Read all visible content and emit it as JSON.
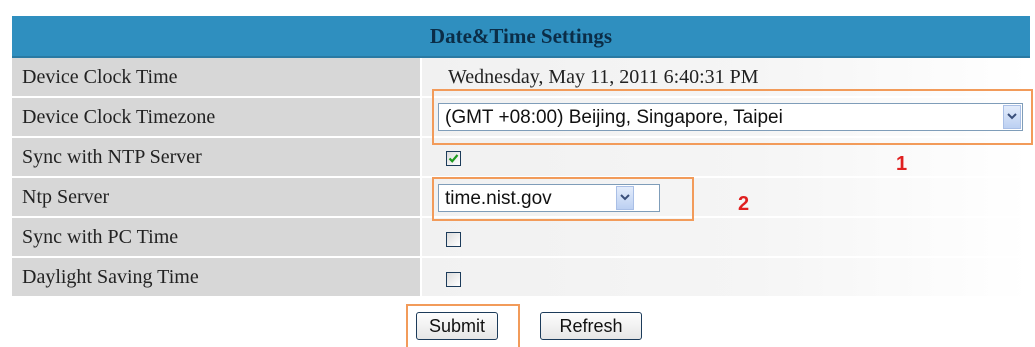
{
  "panel": {
    "title": "Date&Time Settings"
  },
  "fields": {
    "clock_time": {
      "label": "Device Clock Time",
      "value": "Wednesday, May 11, 2011 6:40:31 PM"
    },
    "timezone": {
      "label": "Device Clock Timezone",
      "value": "(GMT +08:00) Beijing, Singapore, Taipei"
    },
    "sync_ntp": {
      "label": "Sync with NTP Server",
      "checked": true
    },
    "ntp_server": {
      "label": "Ntp Server",
      "value": "time.nist.gov"
    },
    "sync_pc": {
      "label": "Sync with PC Time",
      "checked": false
    },
    "dst": {
      "label": "Daylight Saving Time",
      "checked": false
    }
  },
  "annotations": {
    "marker_1": "1",
    "marker_2": "2",
    "highlight_color": "#f29b5a",
    "marker_color": "#e02020"
  },
  "buttons": {
    "submit": "Submit",
    "refresh": "Refresh"
  },
  "colors": {
    "header_bg": "#2f8fbf",
    "label_bg": "#d7d7d7"
  },
  "icons": {
    "checkmark": "checkmark-icon",
    "dropdown": "chevron-down-icon"
  }
}
